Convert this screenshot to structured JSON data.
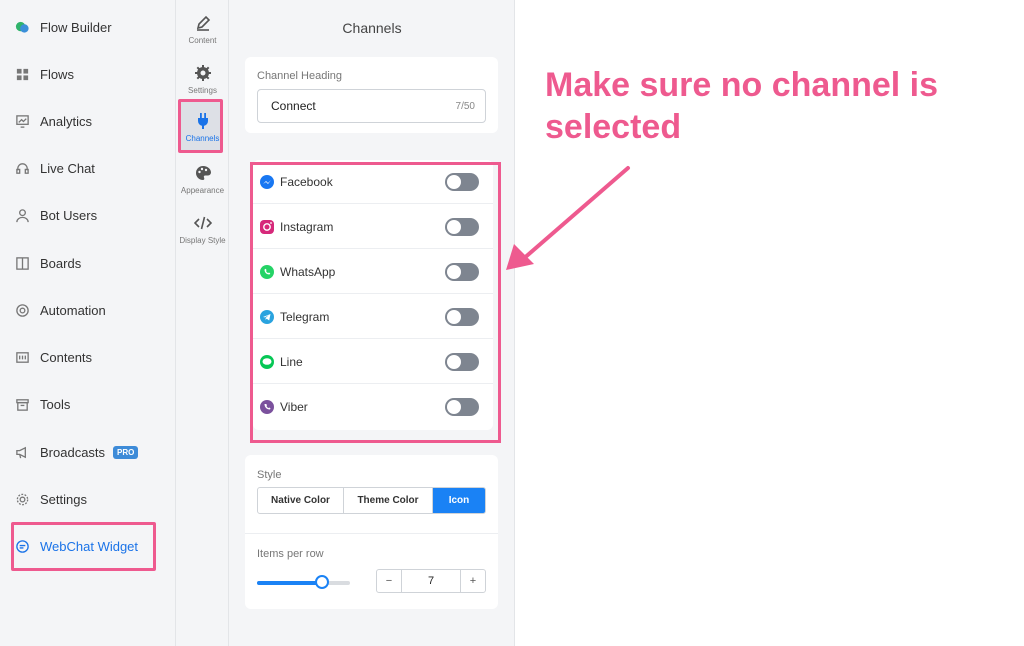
{
  "sidebar": {
    "items": [
      {
        "label": "Flow Builder",
        "icon": "flow-builder-icon"
      },
      {
        "label": "Flows",
        "icon": "grid-icon"
      },
      {
        "label": "Analytics",
        "icon": "analytics-icon"
      },
      {
        "label": "Live Chat",
        "icon": "headset-icon"
      },
      {
        "label": "Bot Users",
        "icon": "user-icon"
      },
      {
        "label": "Boards",
        "icon": "board-icon"
      },
      {
        "label": "Automation",
        "icon": "automation-icon"
      },
      {
        "label": "Contents",
        "icon": "contents-icon"
      },
      {
        "label": "Tools",
        "icon": "toolbox-icon"
      },
      {
        "label": "Broadcasts",
        "icon": "megaphone-icon",
        "badge": "PRO"
      },
      {
        "label": "Settings",
        "icon": "gear-icon"
      },
      {
        "label": "WebChat Widget",
        "icon": "chat-bubble-icon",
        "active": true
      }
    ]
  },
  "tabs": [
    {
      "label": "Content",
      "icon": "pencil-icon"
    },
    {
      "label": "Settings",
      "icon": "gear-icon"
    },
    {
      "label": "Channels",
      "icon": "plug-icon",
      "active": true
    },
    {
      "label": "Appearance",
      "icon": "palette-icon"
    },
    {
      "label": "Display Style",
      "icon": "code-icon"
    }
  ],
  "panel": {
    "title": "Channels",
    "heading_label": "Channel Heading",
    "heading_value": "Connect",
    "heading_counter": "7/50",
    "channels": [
      {
        "label": "Facebook",
        "icon": "messenger-icon",
        "enabled": false
      },
      {
        "label": "Instagram",
        "icon": "instagram-icon",
        "enabled": false
      },
      {
        "label": "WhatsApp",
        "icon": "whatsapp-icon",
        "enabled": false
      },
      {
        "label": "Telegram",
        "icon": "telegram-icon",
        "enabled": false
      },
      {
        "label": "Line",
        "icon": "line-icon",
        "enabled": false
      },
      {
        "label": "Viber",
        "icon": "viber-icon",
        "enabled": false
      }
    ],
    "style_label": "Style",
    "style_options": [
      "Native Color",
      "Theme Color",
      "Icon"
    ],
    "style_selected": "Icon",
    "items_label": "Items per row",
    "items_value": "7",
    "items_fraction": 0.7,
    "stepper_minus": "−",
    "stepper_plus": "+"
  },
  "annotation": {
    "text": "Make sure no channel is selected"
  },
  "colors": {
    "accent": "#1a82f5",
    "highlight": "#ee5a8f",
    "toggle_off": "#7e8590"
  }
}
